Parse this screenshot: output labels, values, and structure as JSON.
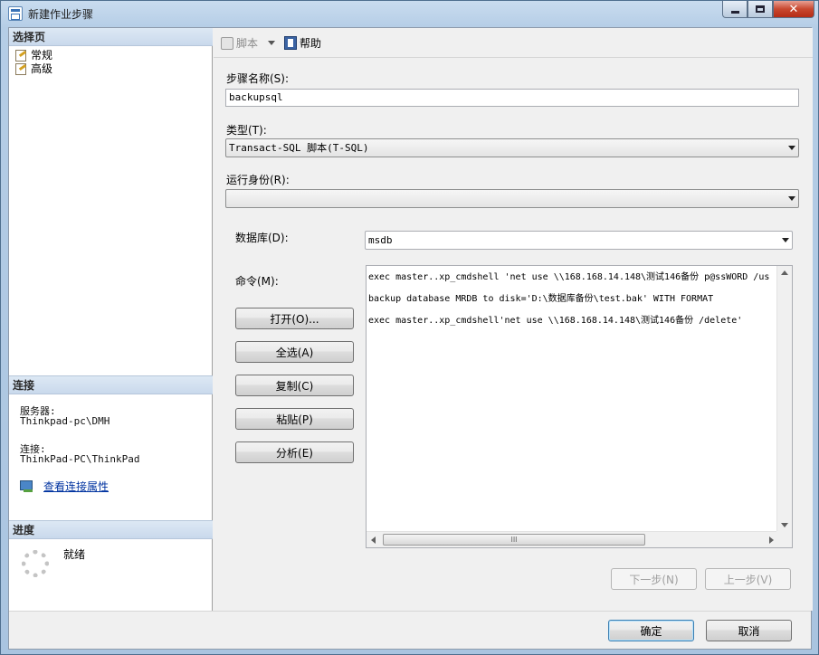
{
  "window": {
    "title": "新建作业步骤"
  },
  "left": {
    "select_page_header": "选择页",
    "pages": [
      {
        "label": "常规"
      },
      {
        "label": "高级"
      }
    ],
    "connection_header": "连接",
    "server_label": "服务器:",
    "server_value": "Thinkpad-pc\\DMH",
    "connection_label": "连接:",
    "connection_value": "ThinkPad-PC\\ThinkPad",
    "view_properties_link": "查看连接属性",
    "progress_header": "进度",
    "progress_status": "就绪"
  },
  "toolbar": {
    "script_label": "脚本",
    "help_label": "帮助"
  },
  "form": {
    "step_name_label": "步骤名称(S):",
    "step_name_value": "backupsql",
    "type_label": "类型(T):",
    "type_value": "Transact-SQL 脚本(T-SQL)",
    "run_as_label": "运行身份(R):",
    "run_as_value": "",
    "database_label": "数据库(D):",
    "database_value": "msdb",
    "command_label": "命令(M):",
    "command_lines": [
      "exec master..xp_cmdshell 'net use \\\\168.168.14.148\\测试146备份 p@ssWORD /us",
      "backup database MRDB to disk='D:\\数据库备份\\test.bak' WITH FORMAT",
      "exec master..xp_cmdshell'net use \\\\168.168.14.148\\测试146备份 /delete'"
    ],
    "scroll_grip": "III",
    "buttons": {
      "open": "打开(O)...",
      "select_all": "全选(A)",
      "copy": "复制(C)",
      "paste": "粘贴(P)",
      "parse": "分析(E)"
    },
    "next_label": "下一步(N)",
    "prev_label": "上一步(V)"
  },
  "footer": {
    "ok_label": "确定",
    "cancel_label": "取消"
  }
}
